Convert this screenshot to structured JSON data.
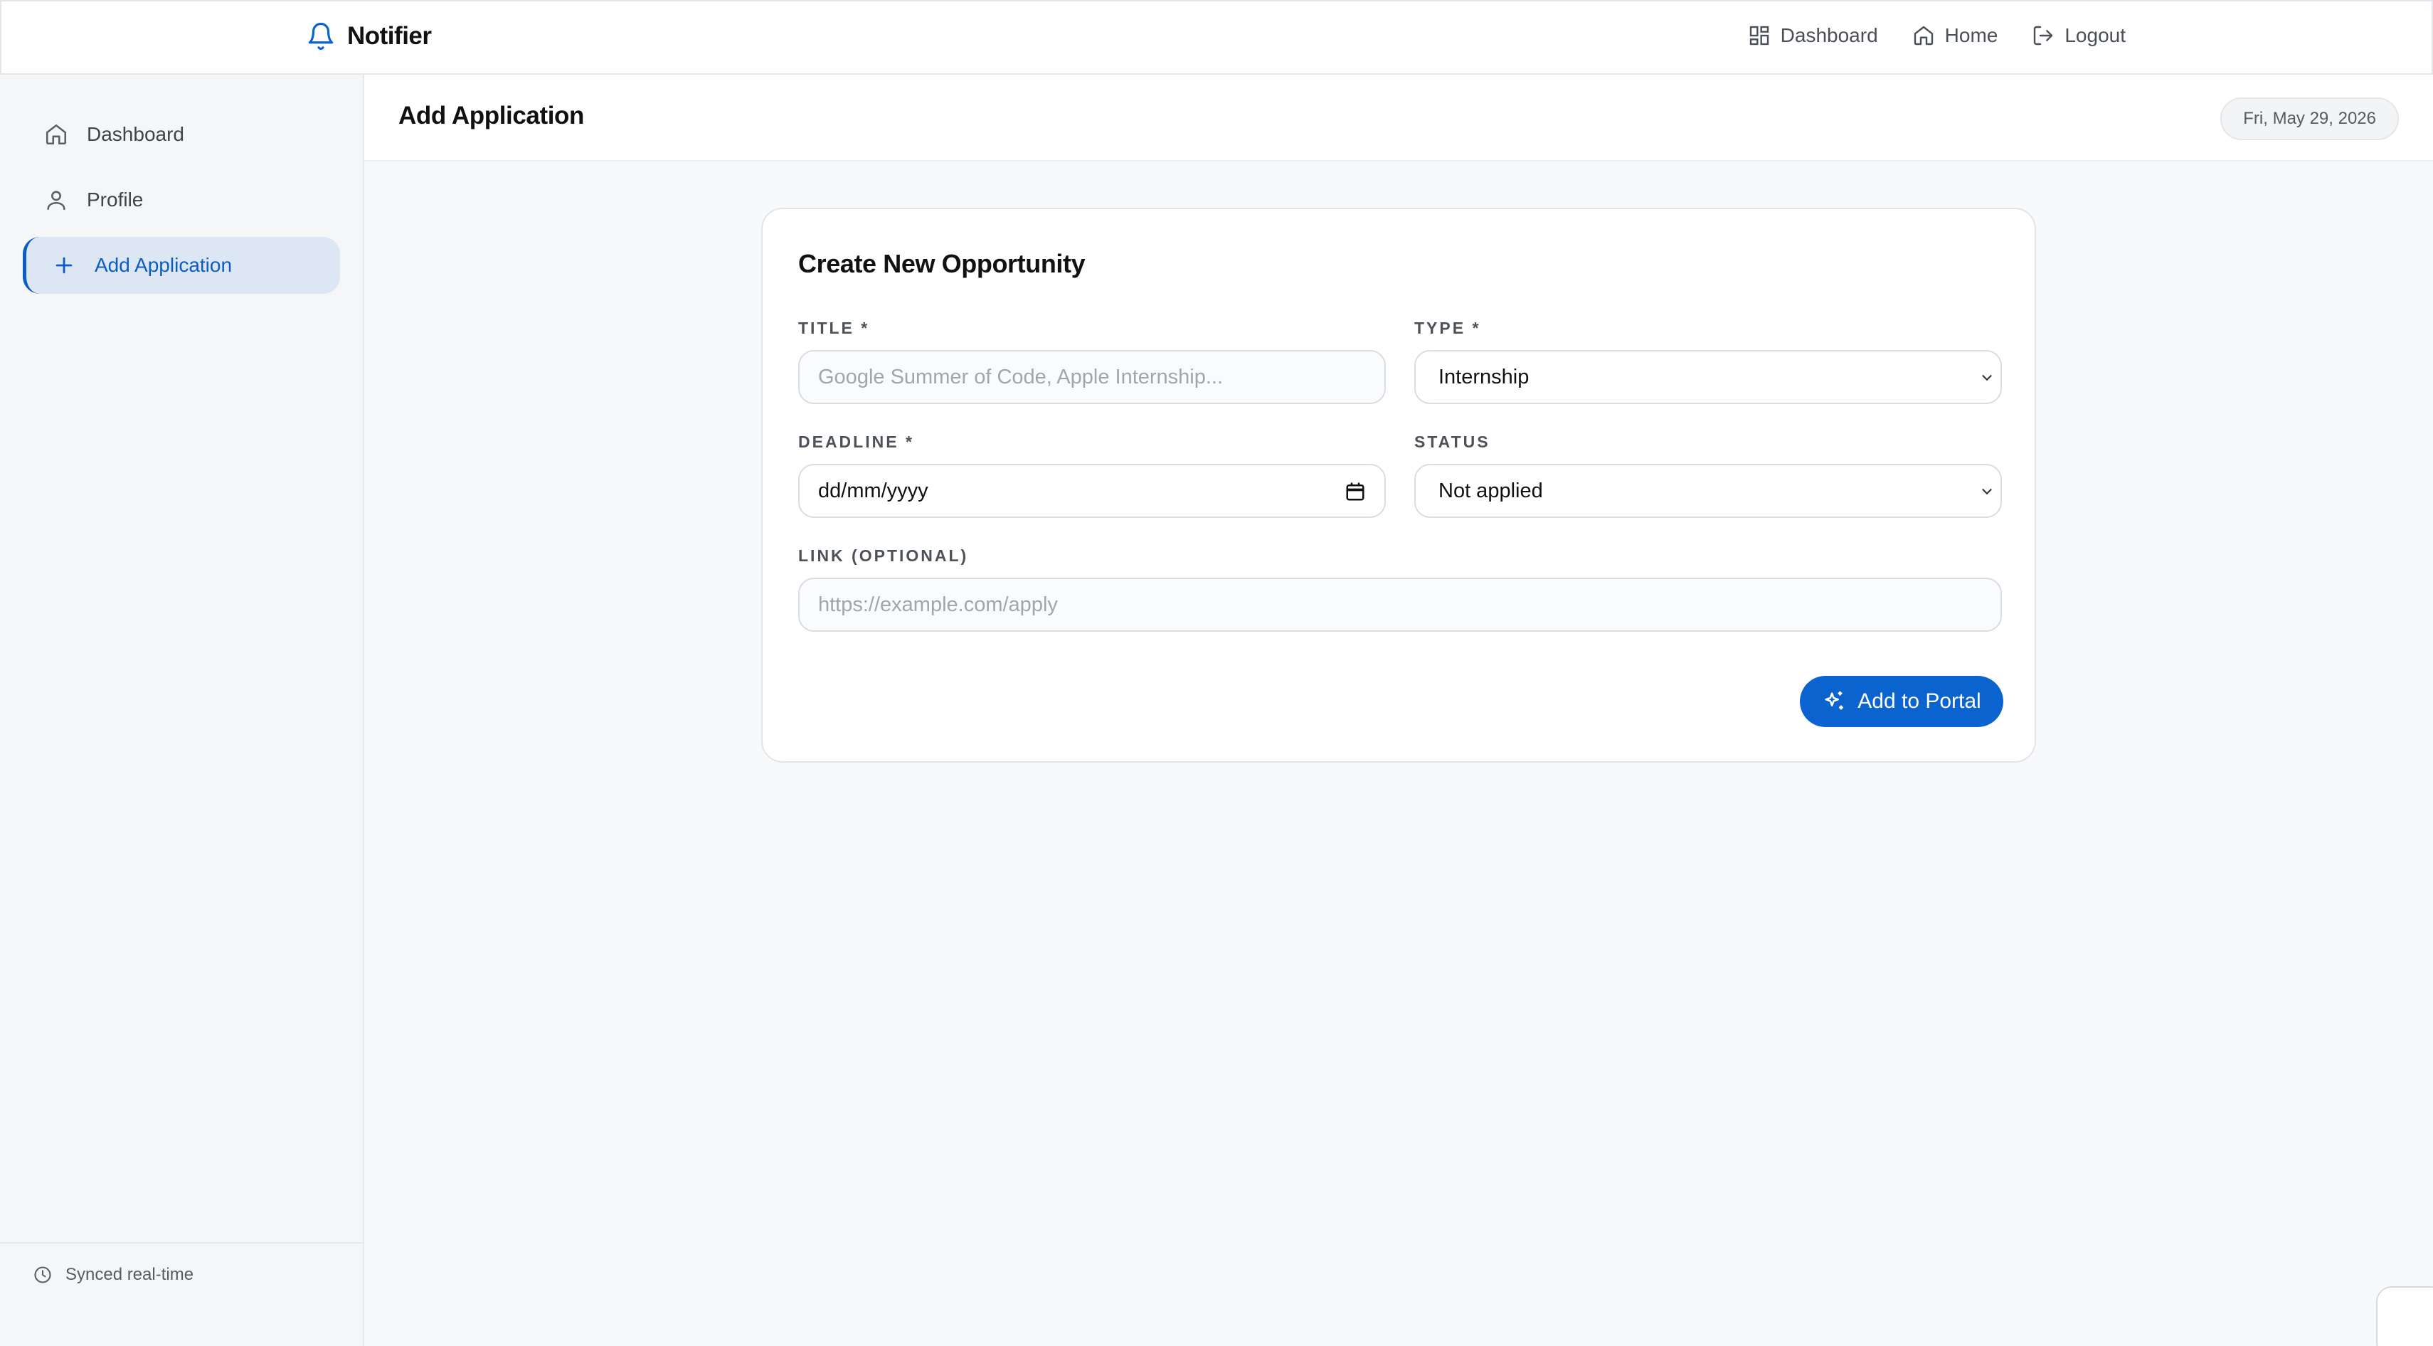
{
  "app": {
    "name": "Notifier"
  },
  "topnav": {
    "dashboard": "Dashboard",
    "home": "Home",
    "logout": "Logout"
  },
  "sidebar": {
    "items": [
      {
        "label": "Dashboard",
        "icon": "home-icon"
      },
      {
        "label": "Profile",
        "icon": "user-icon"
      },
      {
        "label": "Add Application",
        "icon": "plus-icon",
        "active": true
      }
    ],
    "footer": "Synced real-time"
  },
  "header": {
    "title": "Add Application",
    "date": "Fri, May 29, 2026"
  },
  "form": {
    "title": "Create New Opportunity",
    "title_label": "TITLE *",
    "title_placeholder": "Google Summer of Code, Apple Internship...",
    "type_label": "TYPE *",
    "type_value": "Internship",
    "deadline_label": "DEADLINE *",
    "deadline_value": "dd/mm/yyyy",
    "status_label": "STATUS",
    "status_value": "Not applied",
    "link_label": "LINK (OPTIONAL)",
    "link_placeholder": "https://example.com/apply",
    "submit": "Add to Portal"
  },
  "colors": {
    "accent": "#0b63cf",
    "active_bg": "#dde7f4"
  }
}
